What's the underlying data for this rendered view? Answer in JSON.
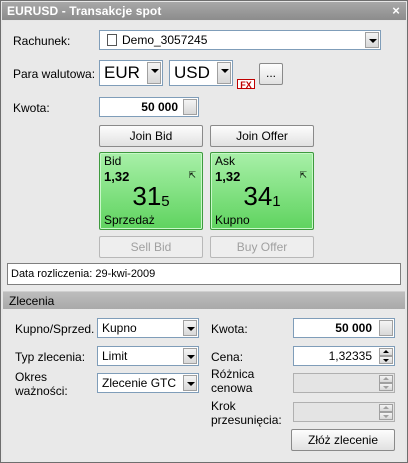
{
  "window": {
    "title": "EURUSD - Transakcje spot",
    "close_glyph": "×"
  },
  "account": {
    "label": "Rachunek:",
    "value": "Demo_3057245"
  },
  "currency": {
    "label": "Para walutowa:",
    "base": "EUR",
    "quote": "USD",
    "fx_badge": "FX",
    "more_label": "..."
  },
  "amount": {
    "label": "Kwota:",
    "value": "50 000"
  },
  "join": {
    "bid_label": "Join Bid",
    "offer_label": "Join Offer"
  },
  "bid_tile": {
    "header": "Bid",
    "prefix": "1,32",
    "big": "31",
    "small": "5",
    "action": "Sprzedaż"
  },
  "ask_tile": {
    "header": "Ask",
    "prefix": "1,32",
    "big": "34",
    "small": "1",
    "action": "Kupno"
  },
  "actions": {
    "sell_bid_label": "Sell Bid",
    "buy_offer_label": "Buy Offer"
  },
  "settlement": {
    "text": "Data rozliczenia: 29-kwi-2009"
  },
  "orders": {
    "section_title": "Zlecenia",
    "side_label": "Kupno/Sprzed.",
    "side_value": "Kupno",
    "type_label": "Typ zlecenia:",
    "type_value": "Limit",
    "validity_label_1": "Okres",
    "validity_label_2": "ważności:",
    "validity_value": "Zlecenie GTC",
    "amount_label": "Kwota:",
    "amount_value": "50 000",
    "price_label": "Cena:",
    "price_value": "1,32335",
    "diff_label_1": "Różnica",
    "diff_label_2": "cenowa",
    "step_label_1": "Krok",
    "step_label_2": "przesunięcia:",
    "submit_label": "Złóż zlecenie"
  },
  "colors": {
    "tile_green": "#5fd35f",
    "fx_red": "#c00000",
    "title_bar": "#8c8c8c"
  }
}
